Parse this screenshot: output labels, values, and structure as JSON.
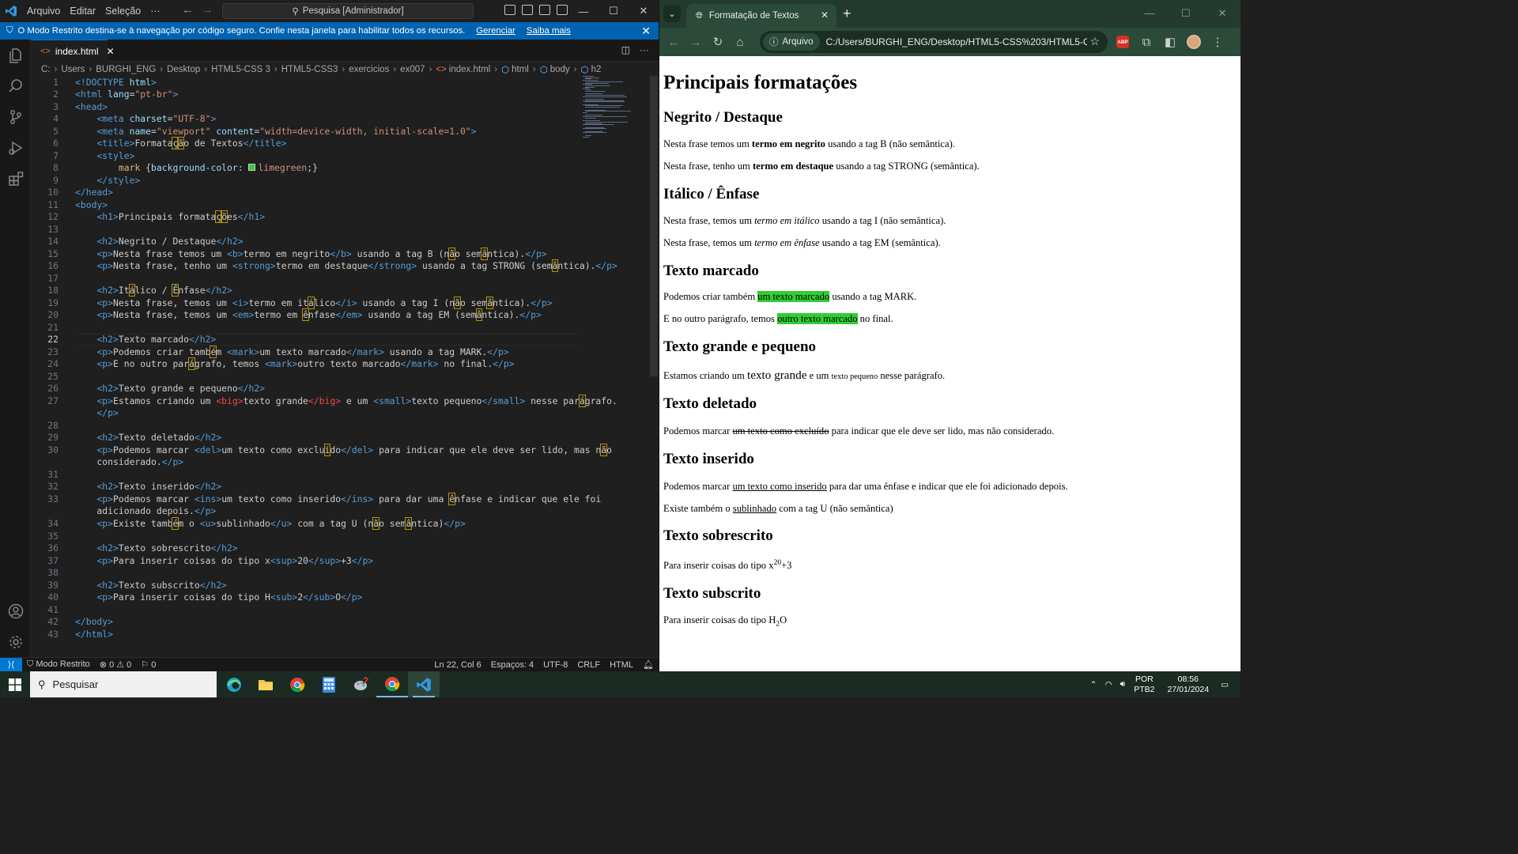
{
  "vscode": {
    "menu": [
      "Arquivo",
      "Editar",
      "Seleção",
      "···"
    ],
    "search_text": "Pesquisa [Administrador]",
    "restricted_banner": {
      "message": "O Modo Restrito destina-se à navegação por código seguro. Confie nesta janela para habilitar todos os recursos.",
      "manage_link": "Gerenciar",
      "learn_link": "Saiba mais"
    },
    "tab": {
      "label": "index.html"
    },
    "breadcrumb": [
      "C:",
      "Users",
      "BURGHI_ENG",
      "Desktop",
      "HTML5-CSS 3",
      "HTML5-CSS3",
      "exercicios",
      "ex007",
      "index.html",
      "html",
      "body",
      "h2"
    ],
    "line_numbers": [
      "1",
      "2",
      "3",
      "4",
      "5",
      "6",
      "7",
      "8",
      "9",
      "10",
      "11",
      "12",
      "13",
      "14",
      "15",
      "16",
      "17",
      "18",
      "19",
      "20",
      "21",
      "22",
      "23",
      "24",
      "25",
      "26",
      "27",
      "",
      "28",
      "29",
      "30",
      "",
      "31",
      "32",
      "33",
      "",
      "34",
      "35",
      "36",
      "37",
      "38",
      "39",
      "40",
      "41",
      "42",
      "43"
    ],
    "current_line": "22",
    "status": {
      "remote_icon": "remote-icon",
      "mode": "Modo Restrito",
      "problems": "⊗ 0 ⚠ 0",
      "ports": "⚐ 0",
      "position": "Ln 22, Col 6",
      "spaces": "Espaços: 4",
      "encoding": "UTF-8",
      "eol": "CRLF",
      "language": "HTML"
    }
  },
  "chrome": {
    "tab_title": "Formatação de Textos",
    "file_chip": "Arquivo",
    "url": "C:/Users/BURGHI_ENG/Desktop/HTML5-CSS%203/HTML5-CSS3...",
    "page": {
      "h1": "Principais formatações",
      "s1_h2": "Negrito / Destaque",
      "s1_p1_a": "Nesta frase temos um ",
      "s1_p1_b": "termo em negrito",
      "s1_p1_c": " usando a tag B (não semântica).",
      "s1_p2_a": "Nesta frase, tenho um ",
      "s1_p2_b": "termo em destaque",
      "s1_p2_c": " usando a tag STRONG (semântica).",
      "s2_h2": "Itálico / Ênfase",
      "s2_p1_a": "Nesta frase, temos um ",
      "s2_p1_b": "termo em itálico",
      "s2_p1_c": " usando a tag I (não semântica).",
      "s2_p2_a": "Nesta frase, temos um ",
      "s2_p2_b": "termo em ênfase",
      "s2_p2_c": " usando a tag EM (semântica).",
      "s3_h2": "Texto marcado",
      "s3_p1_a": "Podemos criar também ",
      "s3_p1_b": "um texto marcado",
      "s3_p1_c": " usando a tag MARK.",
      "s3_p2_a": "E no outro parágrafo, temos ",
      "s3_p2_b": "outro texto marcado",
      "s3_p2_c": " no final.",
      "s4_h2": "Texto grande e pequeno",
      "s4_p1_a": "Estamos criando um ",
      "s4_p1_b": "texto grande",
      "s4_p1_c": " e um ",
      "s4_p1_d": "texto pequeno",
      "s4_p1_e": " nesse parágrafo.",
      "s5_h2": "Texto deletado",
      "s5_p1_a": "Podemos marcar ",
      "s5_p1_b": "um texto como excluído",
      "s5_p1_c": " para indicar que ele deve ser lido, mas não considerado.",
      "s6_h2": "Texto inserido",
      "s6_p1_a": "Podemos marcar ",
      "s6_p1_b": "um texto como inserido",
      "s6_p1_c": " para dar uma ênfase e indicar que ele foi adicionado depois.",
      "s6_p2_a": "Existe também o ",
      "s6_p2_b": "sublinhado",
      "s6_p2_c": " com a tag U (não semântica)",
      "s7_h2": "Texto sobrescrito",
      "s7_p1_a": "Para inserir coisas do tipo x",
      "s7_p1_b": "20",
      "s7_p1_c": "+3",
      "s8_h2": "Texto subscrito",
      "s8_p1_a": "Para inserir coisas do tipo H",
      "s8_p1_b": "2",
      "s8_p1_c": "O"
    }
  },
  "taskbar": {
    "search_placeholder": "Pesquisar",
    "lang_1": "POR",
    "lang_2": "PTB2",
    "time": "08:56",
    "date": "27/01/2024"
  },
  "colors": {
    "vscode_accent": "#0078d4",
    "mark_bg": "#32cd32",
    "chrome_frame": "#2b4a39"
  }
}
